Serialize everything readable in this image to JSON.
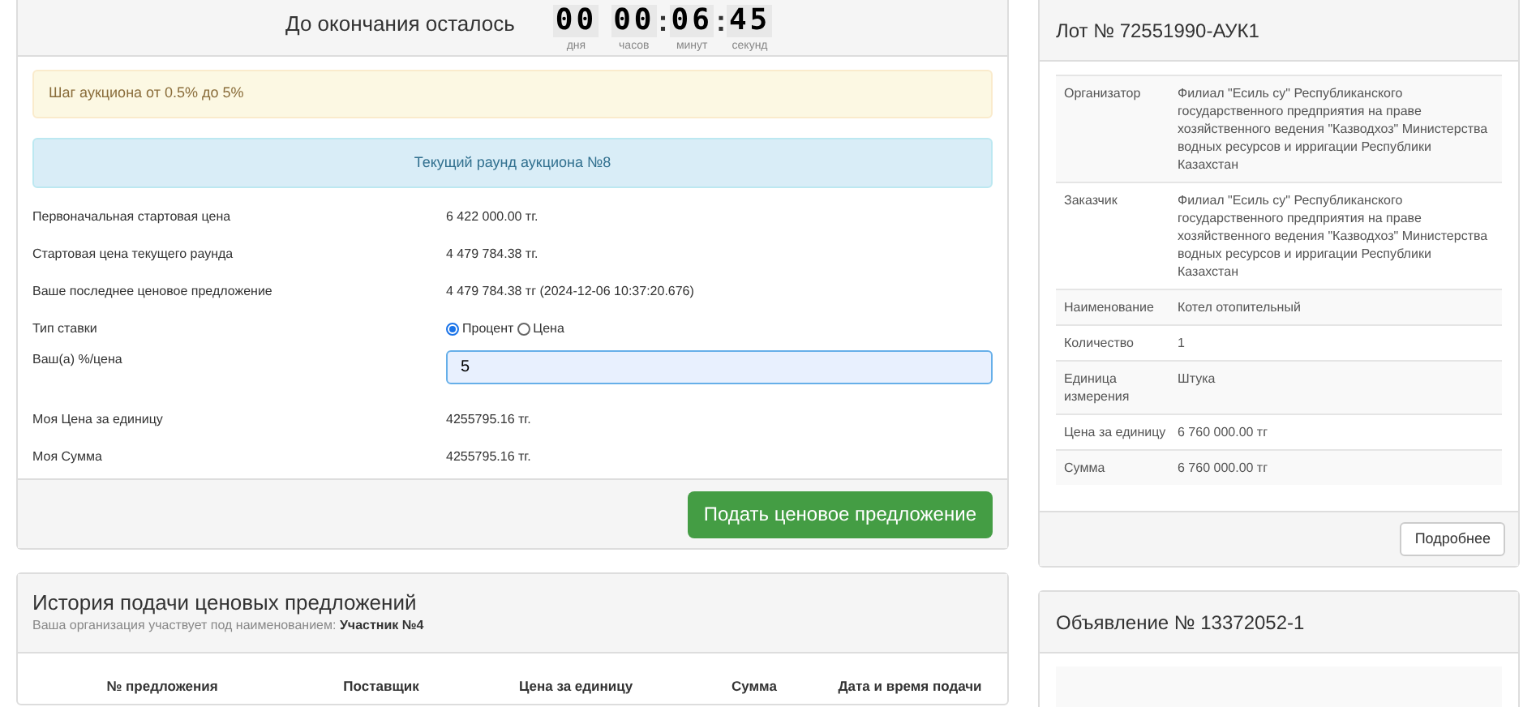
{
  "countdown": {
    "title": "До окончания осталось",
    "units": [
      {
        "digits": "00",
        "label": "дня"
      },
      {
        "digits": "00",
        "label": "часов"
      },
      {
        "digits": "06",
        "label": "минут",
        "separator": ":"
      },
      {
        "digits": "45",
        "label": "секунд",
        "separator": ":"
      }
    ]
  },
  "step_alert": "Шаг аукциона от 0.5% до 5%",
  "round_alert": "Текущий раунд аукциона №8",
  "fields": [
    {
      "kind": "text",
      "label": "Первоначальная стартовая цена",
      "value": "6 422 000.00 тг."
    },
    {
      "kind": "text",
      "label": "Стартовая цена текущего раунда",
      "value": "4 479 784.38 тг."
    },
    {
      "kind": "text",
      "label": "Ваше последнее ценовое предложение",
      "value": "4 479 784.38 тг (2024-12-06 10:37:20.676)"
    },
    {
      "kind": "radio",
      "label": "Тип ставки",
      "options": [
        {
          "label": "Процент",
          "selected": true
        },
        {
          "label": "Цена",
          "selected": false
        }
      ]
    },
    {
      "kind": "input",
      "label": "Ваш(а) %/цена",
      "value": "5"
    },
    {
      "kind": "text",
      "label": "Моя Цена за единицу",
      "value": "4255795.16 тг."
    },
    {
      "kind": "text",
      "label": "Моя Сумма",
      "value": "4255795.16 тг."
    }
  ],
  "submit_button": "Подать ценовое предложение",
  "history": {
    "title": "История подачи ценовых предложений",
    "subtitle": "Ваша организация участвует под наименованием: **Участник №4**",
    "columns": [
      "№ предложения",
      "Поставщик",
      "Цена за единицу",
      "Сумма",
      "Дата и время подачи"
    ]
  },
  "lot": {
    "title": "Лот № 72551990-АУК1",
    "rows": [
      {
        "label": "Организатор",
        "value": "Филиал \"Есиль су\" Республиканского государственного предприятия на праве хозяйственного ведения \"Казводхоз\" Министерства водных ресурсов и ирригации Республики Казахстан"
      },
      {
        "label": "Заказчик",
        "value": "Филиал \"Есиль су\" Республиканского государственного предприятия на праве хозяйственного ведения \"Казводхоз\" Министерства водных ресурсов и ирригации Республики Казахстан"
      },
      {
        "label": "Наименование",
        "value": "Котел отопительный"
      },
      {
        "label": "Количество",
        "value": "1"
      },
      {
        "label": "Единица измерения",
        "value": "Штука"
      },
      {
        "label": "Цена за единицу",
        "value": "6 760 000.00 тг"
      },
      {
        "label": "Сумма",
        "value": "6 760 000.00 тг"
      }
    ],
    "more_button": "Подробнее"
  },
  "announcement": {
    "title": "Объявление № 13372052-1"
  }
}
